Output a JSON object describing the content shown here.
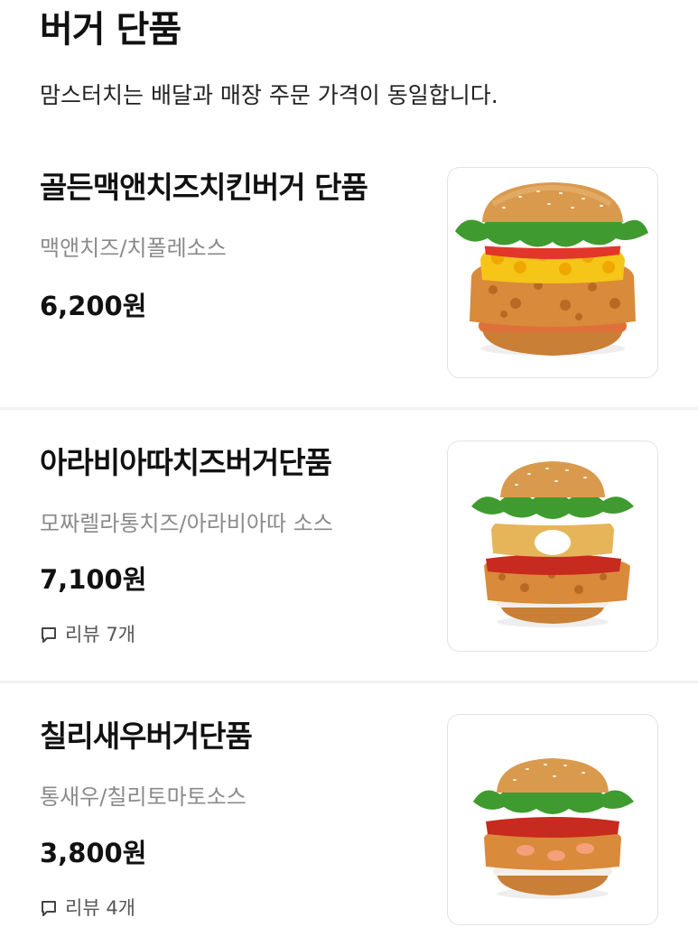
{
  "section": {
    "title": "버거 단품",
    "notice": "맘스터치는 배달과 매장 주문 가격이 동일합니다."
  },
  "items": [
    {
      "name": "골든맥앤치즈치킨버거 단품",
      "desc": "맥앤치즈/치폴레소스",
      "price": "6,200원",
      "review": null,
      "image_icon": "golden-mac-cheese-chicken-burger-image"
    },
    {
      "name": "아라비아따치즈버거단품",
      "desc": "모짜렐라통치즈/아라비아따 소스",
      "price": "7,100원",
      "review": "리뷰 7개",
      "image_icon": "arrabbiata-cheese-burger-image"
    },
    {
      "name": "칠리새우버거단품",
      "desc": "통새우/칠리토마토소스",
      "price": "3,800원",
      "review": "리뷰 4개",
      "image_icon": "chili-shrimp-burger-image"
    }
  ],
  "colors": {
    "bun": "#d99a4e",
    "lettuce": "#3f9b2f",
    "tomato": "#e2362b",
    "cheese": "#f5c518",
    "fried": "#d98a3a",
    "divider": "#f2f2f2"
  }
}
